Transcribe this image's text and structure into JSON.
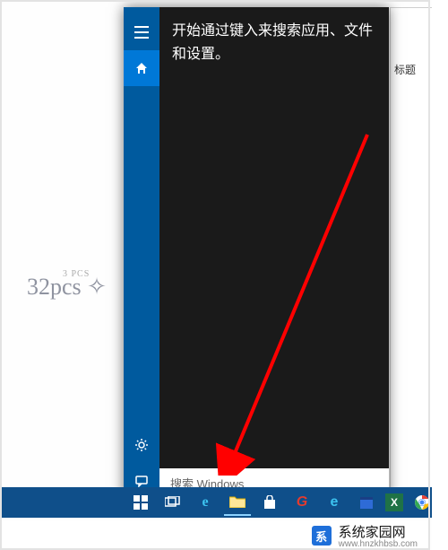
{
  "background_window": {
    "label": "标题"
  },
  "cortana": {
    "hint": "开始通过键入来搜索应用、文件和设置。",
    "search_placeholder": "搜索 Windows",
    "rail_icons": {
      "menu": "menu",
      "home": "home",
      "settings": "settings",
      "feedback": "feedback"
    }
  },
  "taskbar": {
    "items": [
      {
        "name": "start",
        "glyph": "⊞"
      },
      {
        "name": "task-view",
        "glyph": "▭"
      },
      {
        "name": "edge",
        "glyph": "e"
      },
      {
        "name": "file-explorer",
        "glyph": "📁"
      },
      {
        "name": "store",
        "glyph": "🛍"
      },
      {
        "name": "app-red",
        "glyph": "G"
      },
      {
        "name": "ie",
        "glyph": "e"
      },
      {
        "name": "calendar",
        "glyph": "📅"
      },
      {
        "name": "excel",
        "glyph": "X"
      },
      {
        "name": "chrome",
        "glyph": "◉"
      }
    ]
  },
  "logo": {
    "small_text": "3 PCS",
    "script_text": "32pcs ✧"
  },
  "watermark": {
    "brand": "系统家园网",
    "url": "www.hnzkhbsb.com",
    "logo_letter": "系"
  },
  "arrow_color": "#ff0000"
}
